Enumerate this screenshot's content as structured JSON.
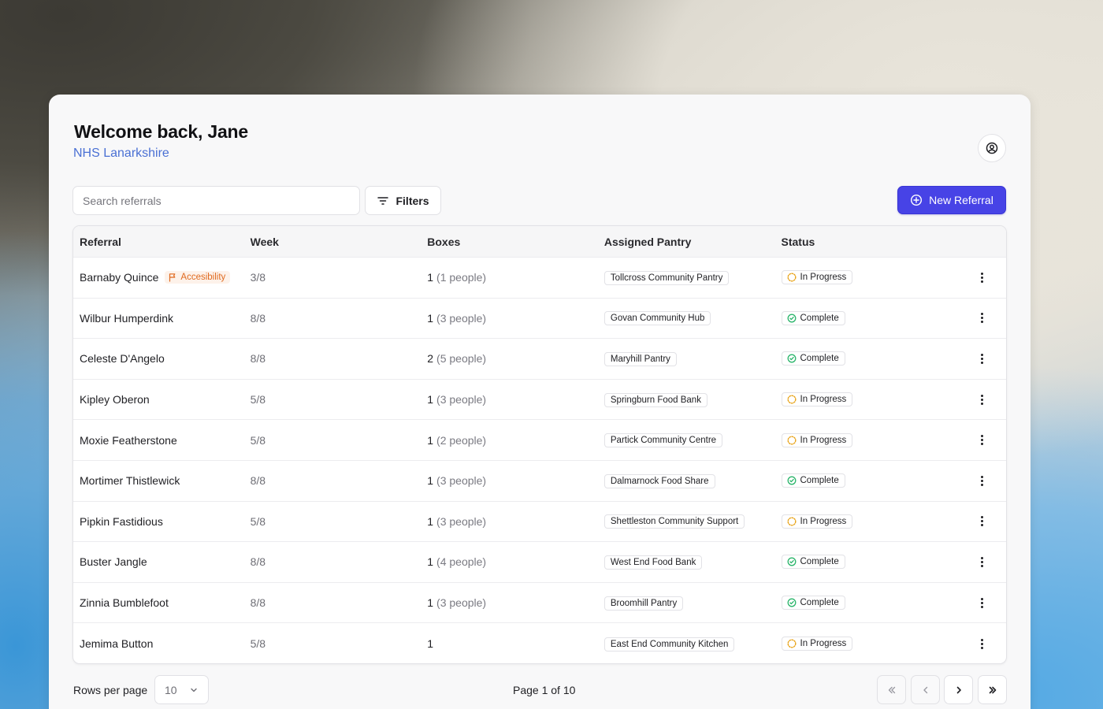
{
  "header": {
    "welcome": "Welcome back, Jane",
    "organization": "NHS Lanarkshire",
    "profile_icon": "user-circle-icon"
  },
  "toolbar": {
    "search_placeholder": "Search referrals",
    "filters_label": "Filters",
    "new_referral_label": "New Referral"
  },
  "table": {
    "columns": [
      "Referral",
      "Week",
      "Boxes",
      "Assigned Pantry",
      "Status"
    ],
    "rows": [
      {
        "name": "Barnaby Quince",
        "flag": "Accesibility",
        "week": "3/8",
        "boxes": "1",
        "people": "(1 people)",
        "pantry": "Tollcross Community Pantry",
        "status": "In Progress"
      },
      {
        "name": "Wilbur Humperdink",
        "flag": "",
        "week": "8/8",
        "boxes": "1",
        "people": "(3 people)",
        "pantry": "Govan Community Hub",
        "status": "Complete"
      },
      {
        "name": "Celeste D'Angelo",
        "flag": "",
        "week": "8/8",
        "boxes": "2",
        "people": "(5 people)",
        "pantry": "Maryhill Pantry",
        "status": "Complete"
      },
      {
        "name": "Kipley Oberon",
        "flag": "",
        "week": "5/8",
        "boxes": "1",
        "people": "(3 people)",
        "pantry": "Springburn Food Bank",
        "status": "In Progress"
      },
      {
        "name": "Moxie Featherstone",
        "flag": "",
        "week": "5/8",
        "boxes": "1",
        "people": "(2 people)",
        "pantry": "Partick Community Centre",
        "status": "In Progress"
      },
      {
        "name": "Mortimer Thistlewick",
        "flag": "",
        "week": "8/8",
        "boxes": "1",
        "people": "(3 people)",
        "pantry": "Dalmarnock Food Share",
        "status": "Complete"
      },
      {
        "name": "Pipkin Fastidious",
        "flag": "",
        "week": "5/8",
        "boxes": "1",
        "people": "(3 people)",
        "pantry": "Shettleston Community Support",
        "status": "In Progress"
      },
      {
        "name": "Buster Jangle",
        "flag": "",
        "week": "8/8",
        "boxes": "1",
        "people": "(4 people)",
        "pantry": "West End Food Bank",
        "status": "Complete"
      },
      {
        "name": "Zinnia Bumblefoot",
        "flag": "",
        "week": "8/8",
        "boxes": "1",
        "people": "(3 people)",
        "pantry": "Broomhill Pantry",
        "status": "Complete"
      },
      {
        "name": "Jemima Button",
        "flag": "",
        "week": "5/8",
        "boxes": "1",
        "people": "",
        "pantry": "East End Community Kitchen",
        "status": "In Progress"
      }
    ]
  },
  "pagination": {
    "rows_per_page_label": "Rows per page",
    "rows_per_page_value": "10",
    "page_info": "Page 1 of 10"
  },
  "colors": {
    "accent": "#4743e6",
    "org_link": "#4a70d4",
    "complete": "#2bb56b",
    "in_progress": "#e8a317",
    "accessibility": "#e06a1f"
  }
}
